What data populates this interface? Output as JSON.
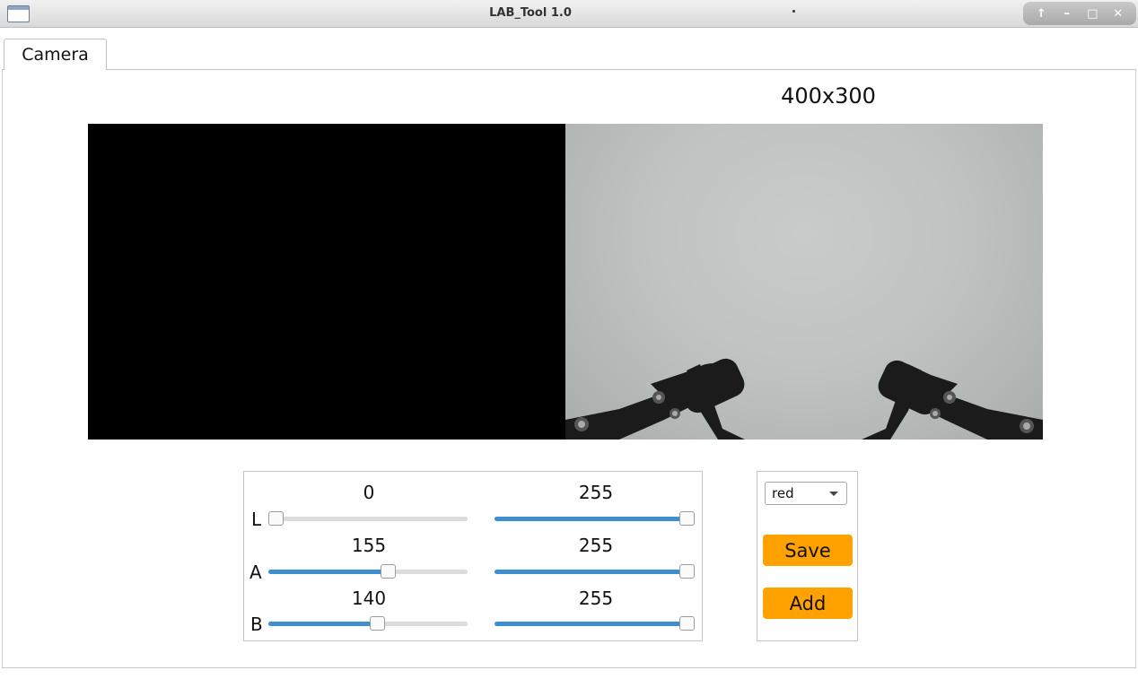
{
  "window": {
    "title": "LAB_Tool 1.0"
  },
  "titlebar_controls": [
    "↑",
    "–",
    "□",
    "✕"
  ],
  "tabs": [
    {
      "label": "Camera",
      "active": true
    }
  ],
  "camera": {
    "resolution": "400x300",
    "mask_color": "#000000"
  },
  "lab": {
    "channels": [
      {
        "name": "L",
        "min": 0,
        "max": 255,
        "min_label": "0",
        "max_label": "255"
      },
      {
        "name": "A",
        "min": 155,
        "max": 255,
        "min_label": "155",
        "max_label": "255"
      },
      {
        "name": "B",
        "min": 140,
        "max": 255,
        "min_label": "140",
        "max_label": "255"
      }
    ],
    "range_max": 255
  },
  "controls": {
    "color_selected": "red",
    "save_label": "Save",
    "add_label": "Add"
  },
  "colors": {
    "accent": "#ffa200",
    "slider_fill": "#3d8fd1"
  }
}
